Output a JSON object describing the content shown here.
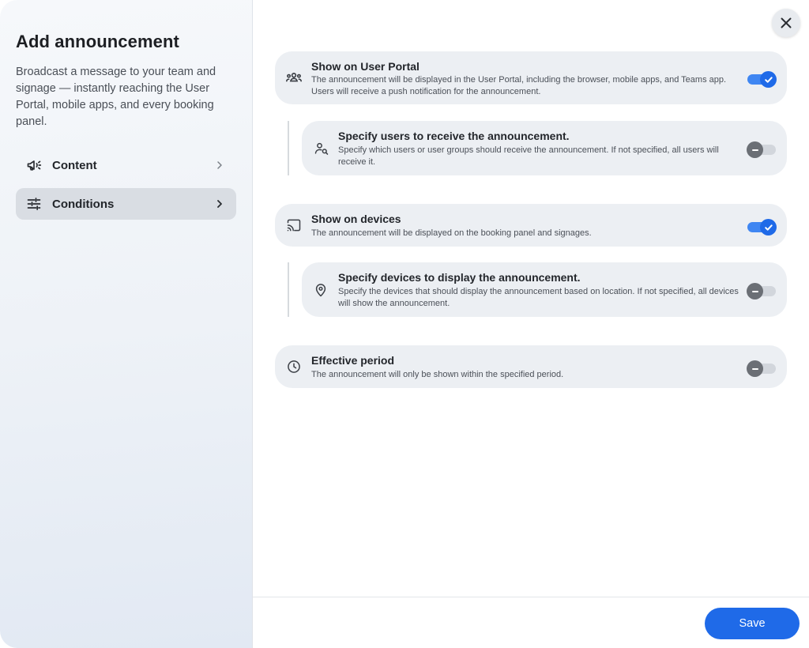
{
  "dialog": {
    "title": "Add announcement",
    "description": "Broadcast a message to your team and signage — instantly reaching the User Portal, mobile apps, and every booking panel."
  },
  "nav": {
    "items": [
      {
        "label": "Content",
        "icon": "megaphone-icon",
        "active": false
      },
      {
        "label": "Conditions",
        "icon": "sliders-icon",
        "active": true
      }
    ]
  },
  "conditions": {
    "user_portal": {
      "title": "Show on User Portal",
      "description": "The announcement will be displayed in the User Portal, including the browser, mobile apps, and Teams app. Users will receive a push notification for the announcement.",
      "icon": "people-icon",
      "enabled": true
    },
    "specify_users": {
      "title": "Specify users to receive the announcement.",
      "description": "Specify which users or user groups should receive the announcement. If not specified, all users will receive it.",
      "icon": "user-search-icon",
      "enabled": false
    },
    "devices": {
      "title": "Show on devices",
      "description": "The announcement will be displayed on the booking panel and signages.",
      "icon": "cast-icon",
      "enabled": true
    },
    "specify_devices": {
      "title": "Specify devices to display the announcement.",
      "description": "Specify the devices that should display the announcement based on location. If not specified, all devices will show the announcement.",
      "icon": "location-pin-icon",
      "enabled": false
    },
    "effective_period": {
      "title": "Effective period",
      "description": "The announcement will only be shown within the specified period.",
      "icon": "clock-icon",
      "enabled": false
    }
  },
  "footer": {
    "save_label": "Save"
  },
  "colors": {
    "accent": "#1f6ae8",
    "card_bg": "#eceff3",
    "nav_active_bg": "#d9dde3"
  }
}
